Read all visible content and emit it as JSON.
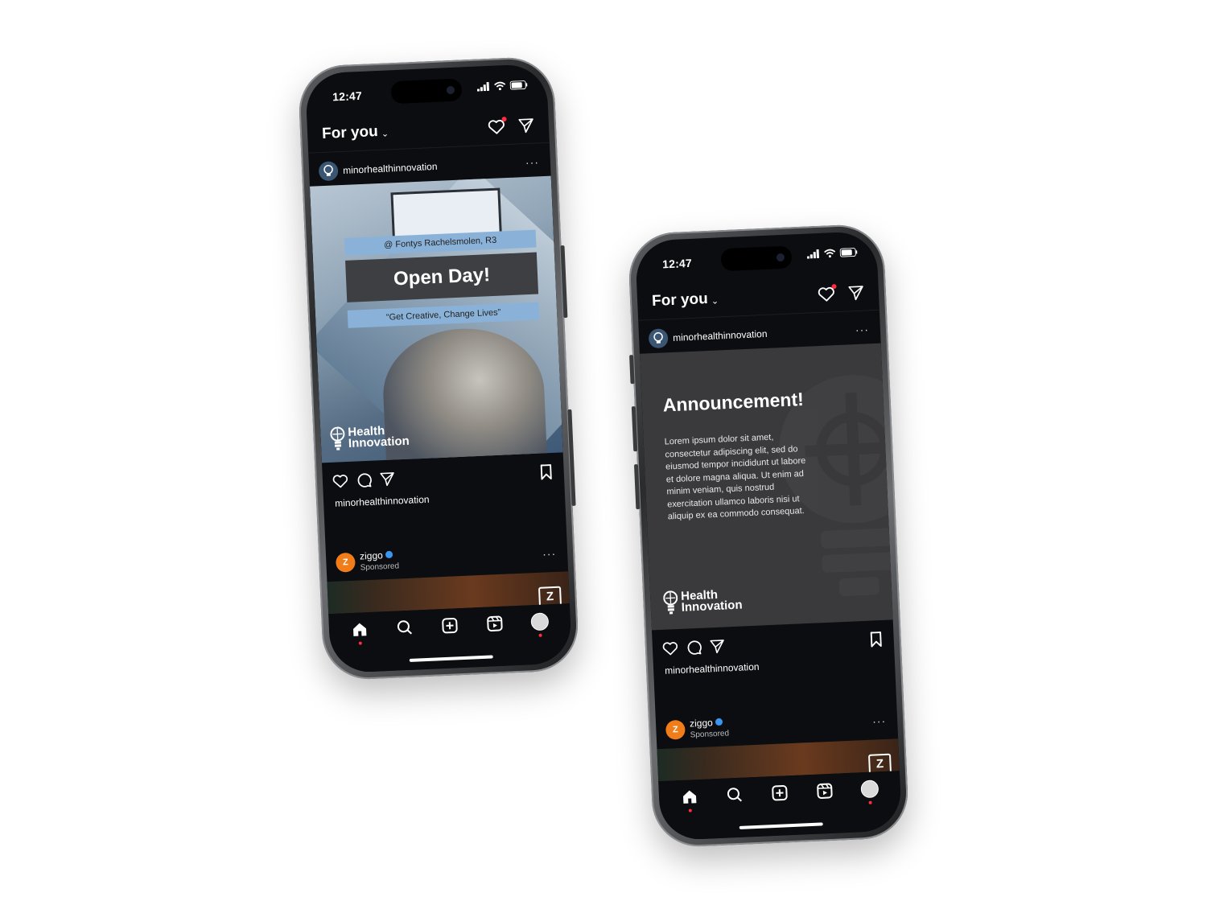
{
  "status": {
    "time": "12:47"
  },
  "header": {
    "title": "For you",
    "chevron": "⌄"
  },
  "post1": {
    "username": "minorhealthinnovation",
    "more": "···",
    "image": {
      "location": "@ Fontys Rachelsmolen, R3",
      "headline": "Open Day!",
      "tagline": "“Get Creative, Change Lives”",
      "brand_line1": "Health",
      "brand_line2": "Innovation"
    },
    "caption_user": "minorhealthinnovation"
  },
  "post2": {
    "username": "minorhealthinnovation",
    "more": "···",
    "image": {
      "headline": "Announcement!",
      "body": "Lorem ipsum dolor sit amet, consectetur adipiscing elit, sed do eiusmod tempor incididunt ut labore et dolore magna aliqua. Ut enim ad minim veniam, quis nostrud exercitation ullamco laboris nisi ut aliquip ex ea commodo consequat.",
      "brand_line1": "Health",
      "brand_line2": "Innovation"
    },
    "caption_user": "minorhealthinnovation"
  },
  "ad": {
    "name": "ziggo",
    "label": "Sponsored",
    "avatar_letter": "Z",
    "more": "···",
    "badge": "Z"
  },
  "nav": [
    "home-icon",
    "search-icon",
    "create-icon",
    "reels-icon",
    "profile-avatar"
  ],
  "colors": {
    "background": "#0c0d10",
    "accent_red": "#ff2d40",
    "band_blue": "#8ab2d8",
    "ziggo_orange": "#f07d1a",
    "verified_blue": "#3897f0"
  }
}
